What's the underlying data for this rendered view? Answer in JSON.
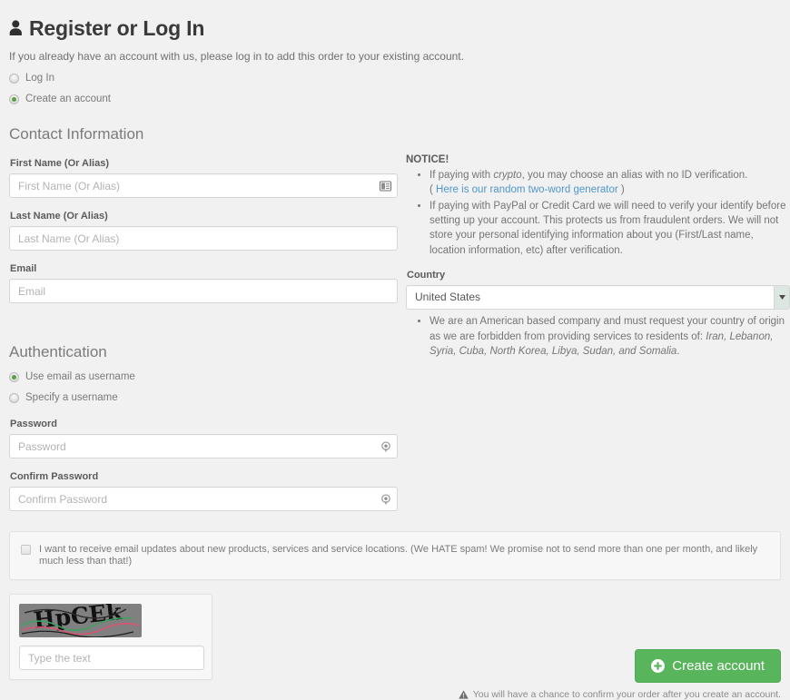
{
  "header": {
    "icon": "user-icon",
    "title": "Register or Log In",
    "intro": "If you already have an account with us, please log in to add this order to your existing account."
  },
  "account_mode": {
    "options": [
      {
        "label": "Log In",
        "selected": false
      },
      {
        "label": "Create an account",
        "selected": true
      }
    ]
  },
  "contact": {
    "heading": "Contact Information",
    "first_name": {
      "label": "First Name (Or Alias)",
      "placeholder": "First Name (Or Alias)",
      "value": "",
      "icon": "contact-card-icon"
    },
    "last_name": {
      "label": "Last Name (Or Alias)",
      "placeholder": "Last Name (Or Alias)",
      "value": ""
    },
    "email": {
      "label": "Email",
      "placeholder": "Email",
      "value": ""
    }
  },
  "notice": {
    "title": "NOTICE!",
    "item1_before": "If paying with ",
    "item1_em": "crypto",
    "item1_after": ", you may choose an alias with no ID verification.",
    "item1_paren_open": "( ",
    "item1_link": "Here is our random two-word generator",
    "item1_paren_close": " )",
    "item2": "If paying with PayPal or Credit Card we will need to verify your identify before setting up your account. This protects us from fraudulent orders. We will not store your personal identifying information about you (First/Last name, location information, etc) after verification."
  },
  "country": {
    "label": "Country",
    "selected": "United States",
    "options": [
      "United States"
    ],
    "note_before": "We are an American based company and must request your country of origin as we are forbidden from providing services to residents of: ",
    "note_em": "Iran, Lebanon, Syria, Cuba, North Korea, Libya, Sudan, and Somalia",
    "note_after": "."
  },
  "authentication": {
    "heading": "Authentication",
    "options": [
      {
        "label": "Use email as username",
        "selected": true
      },
      {
        "label": "Specify a username",
        "selected": false
      }
    ],
    "password": {
      "label": "Password",
      "placeholder": "Password",
      "value": "",
      "icon": "key-icon"
    },
    "confirm_password": {
      "label": "Confirm Password",
      "placeholder": "Confirm Password",
      "value": "",
      "icon": "key-icon"
    }
  },
  "newsletter": {
    "checked": false,
    "label": "I want to receive email updates about new products, services and service locations. (We HATE spam! We promise not to send more than one per month, and likely much less than that!)"
  },
  "captcha": {
    "text": "HpCEk",
    "placeholder": "Type the text",
    "value": "",
    "background_color": "#808080",
    "text_color": "#111111",
    "line_colors": [
      "#3aa35f",
      "#e05070"
    ]
  },
  "submit": {
    "icon": "plus-circle-icon",
    "label": "Create account",
    "note_icon": "warning-triangle-icon",
    "note": "You will have a chance to confirm your order after you create an account.",
    "button_color": "#58b55c"
  }
}
